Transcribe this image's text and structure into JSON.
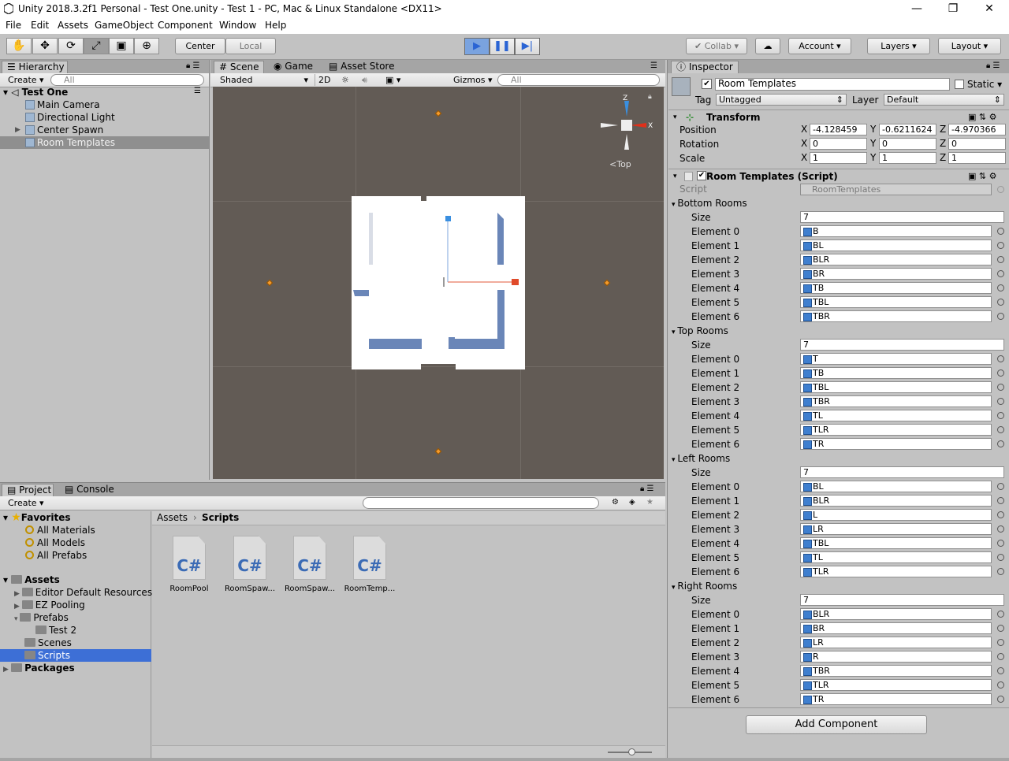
{
  "window": {
    "title": "Unity 2018.3.2f1 Personal - Test One.unity - Test 1 - PC, Mac & Linux Standalone <DX11>"
  },
  "menu": [
    "File",
    "Edit",
    "Assets",
    "GameObject",
    "Component",
    "Window",
    "Help"
  ],
  "toolbar": {
    "pivot": "Center",
    "space": "Local",
    "collab": "Collab",
    "account": "Account",
    "layers": "Layers",
    "layout": "Layout"
  },
  "hierarchy": {
    "tab": "Hierarchy",
    "create": "Create",
    "search_placeholder": "All",
    "scene": "Test One",
    "items": [
      "Main Camera",
      "Directional Light",
      "Center Spawn",
      "Room Templates"
    ]
  },
  "scene": {
    "tabs": [
      "Scene",
      "Game",
      "Asset Store"
    ],
    "shading": "Shaded",
    "mode2d": "2D",
    "gizmos": "Gizmos",
    "search_placeholder": "All",
    "view_label": "Top",
    "axis_labels": {
      "z": "Z",
      "x": "X"
    }
  },
  "project": {
    "tabs": [
      "Project",
      "Console"
    ],
    "create": "Create",
    "favorites_label": "Favorites",
    "favorites": [
      "All Materials",
      "All Models",
      "All Prefabs"
    ],
    "assets_label": "Assets",
    "assets": [
      "Editor Default Resources",
      "EZ Pooling",
      "Prefabs",
      "Test 2",
      "Scenes",
      "Scripts"
    ],
    "packages_label": "Packages",
    "breadcrumb": [
      "Assets",
      "Scripts"
    ],
    "files": [
      "RoomPool",
      "RoomSpaw...",
      "RoomSpaw...",
      "RoomTemp..."
    ],
    "file_icon_text": "C#"
  },
  "inspector": {
    "tab": "Inspector",
    "object_name": "Room Templates",
    "static_label": "Static",
    "tag_label": "Tag",
    "tag_value": "Untagged",
    "layer_label": "Layer",
    "layer_value": "Default",
    "transform": {
      "title": "Transform",
      "position_label": "Position",
      "rotation_label": "Rotation",
      "scale_label": "Scale",
      "position": [
        "-4.128459",
        "-0.6211624",
        "-4.970366"
      ],
      "rotation": [
        "0",
        "0",
        "0"
      ],
      "scale": [
        "1",
        "1",
        "1"
      ],
      "axes": [
        "X",
        "Y",
        "Z"
      ]
    },
    "script_component": {
      "title": "Room Templates (Script)",
      "script_label": "Script",
      "script_value": "RoomTemplates",
      "size_label": "Size",
      "element_labels": [
        "Element 0",
        "Element 1",
        "Element 2",
        "Element 3",
        "Element 4",
        "Element 5",
        "Element 6"
      ],
      "arrays": [
        {
          "name": "Bottom Rooms",
          "size": "7",
          "values": [
            "B",
            "BL",
            "BLR",
            "BR",
            "TB",
            "TBL",
            "TBR"
          ]
        },
        {
          "name": "Top Rooms",
          "size": "7",
          "values": [
            "T",
            "TB",
            "TBL",
            "TBR",
            "TL",
            "TLR",
            "TR"
          ]
        },
        {
          "name": "Left Rooms",
          "size": "7",
          "values": [
            "BL",
            "BLR",
            "L",
            "LR",
            "TBL",
            "TL",
            "TLR"
          ]
        },
        {
          "name": "Right Rooms",
          "size": "7",
          "values": [
            "BLR",
            "BR",
            "LR",
            "R",
            "TBR",
            "TLR",
            "TR"
          ]
        }
      ]
    },
    "add_component": "Add Component"
  }
}
